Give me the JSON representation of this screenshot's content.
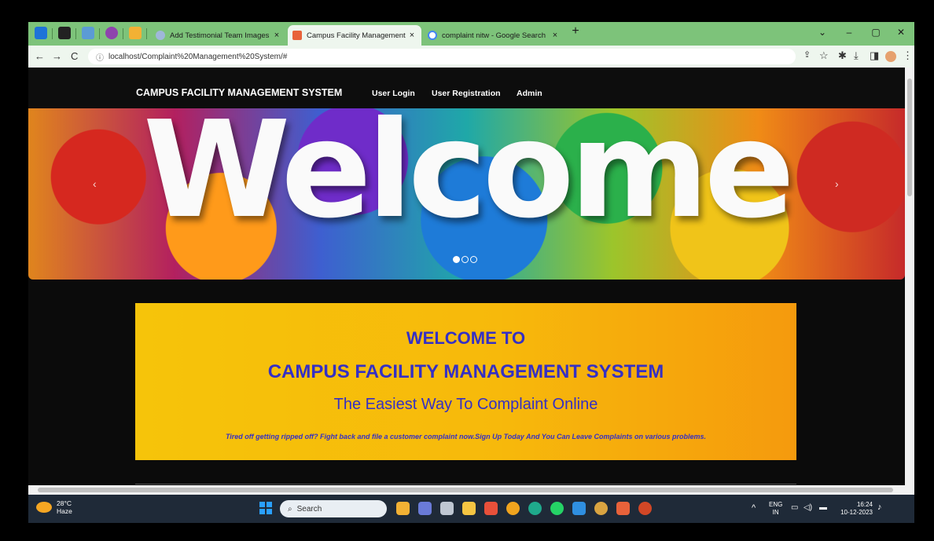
{
  "browser": {
    "tabs": [
      {
        "title": "Add Testimonial Team Images",
        "favicon_color": "#9fb7d9",
        "active": false
      },
      {
        "title": "Campus Facility Management Sy",
        "favicon_color": "#e8623a",
        "active": true
      },
      {
        "title": "complaint nitw - Google Search",
        "favicon_color": "#4285f4",
        "active": false
      }
    ],
    "new_tab_label": "+",
    "close_glyph": "×",
    "url": "localhost/Complaint%20Management%20System/#",
    "nav_glyphs": {
      "back": "←",
      "forward": "→",
      "reload": "C"
    },
    "toolbar_glyphs": {
      "share": "⇪",
      "star": "☆",
      "extensions": "✱",
      "download": "⤓",
      "sidepanel": "◨",
      "menu": "⋮"
    },
    "window_glyphs": {
      "chevron": "⌄",
      "minimize": "–",
      "maximize": "▢",
      "close": "✕"
    }
  },
  "site": {
    "brand": "CAMPUS FACILITY MANAGEMENT SYSTEM",
    "nav_links": [
      "User Login",
      "User Registration",
      "Admin"
    ],
    "carousel": {
      "word": "Welcome",
      "prev_glyph": "‹",
      "next_glyph": "›",
      "slide_count": 3,
      "active_slide": 1
    },
    "banner": {
      "line1": "WELCOME TO",
      "line2": "CAMPUS FACILITY MANAGEMENT SYSTEM",
      "line3": "The Easiest Way To Complaint Online",
      "line4": "Tired off getting ripped off? Fight back and file a customer complaint now.Sign Up Today And You Can Leave Complaints on various problems."
    }
  },
  "taskbar": {
    "weather_temp": "28°C",
    "weather_desc": "Haze",
    "search_placeholder": "Search",
    "search_glyph": "⌕",
    "tray_up_glyph": "^",
    "lang_line1": "ENG",
    "lang_line2": "IN",
    "time": "16:24",
    "date": "10-12-2023",
    "app_icons": [
      "file-explorer-icon",
      "brave-icon",
      "chrome-icon",
      "edge-icon",
      "whatsapp-icon",
      "vscode-icon",
      "chrome-profile-icon",
      "xampp-icon",
      "powerpoint-icon"
    ]
  },
  "colors": {
    "tab_bar": "#7dc37a",
    "banner_text": "#3530c4",
    "banner_bg": "#f6c40a",
    "taskbar": "#1f2a38"
  }
}
